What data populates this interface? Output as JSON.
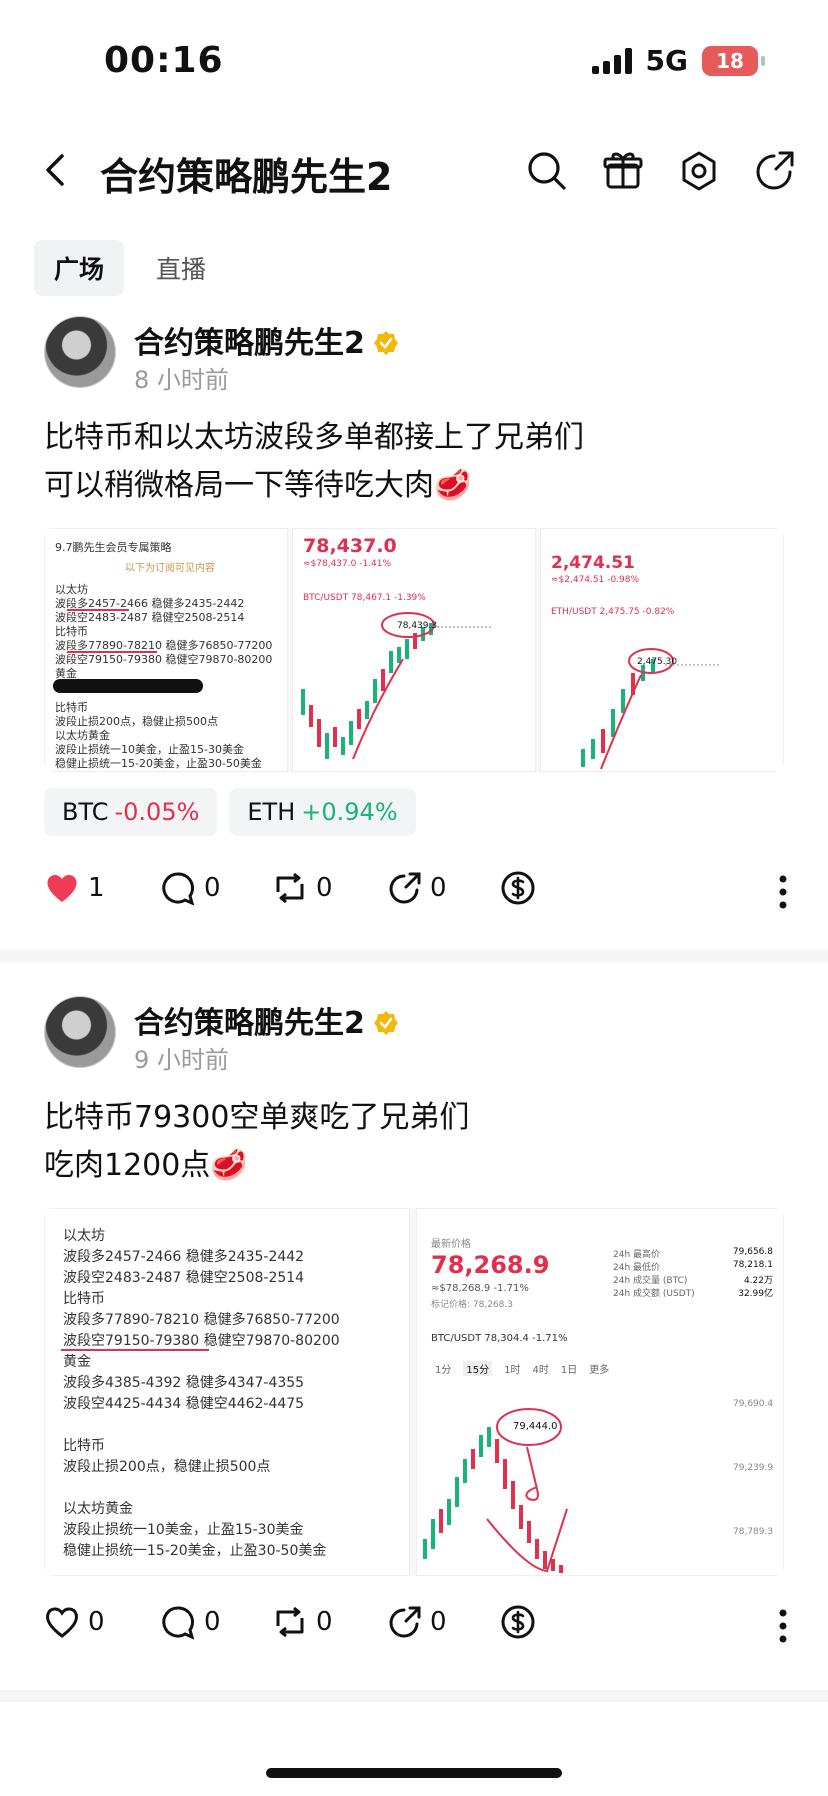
{
  "status": {
    "time": "00:16",
    "network": "5G",
    "battery": "18"
  },
  "nav": {
    "title": "合约策略鹏先生2"
  },
  "tabs": [
    {
      "label": "广场",
      "active": true
    },
    {
      "label": "直播",
      "active": false
    }
  ],
  "posts": [
    {
      "author": "合约策略鹏先生2",
      "time": "8 小时前",
      "lines": [
        "比特币和以太坊波段多单都接上了兄弟们",
        "可以稍微格局一下等待吃大肉🥩"
      ],
      "images": {
        "note_title": "9.7鹏先生会员专属策略",
        "note_sub": "以下为订阅可见内容",
        "note_lines": [
          "以太坊",
          "波段多2457-2466 稳健多2435-2442",
          "波段空2483-2487 稳健空2508-2514",
          "比特币",
          "波段多77890-78210 稳健多76850-77200",
          "波段空79150-79380 稳健空79870-80200",
          "黄金",
          "",
          "比特币",
          "波段止损200点，稳健止损500点",
          "以太坊黄金",
          "波段止损统一10美金，止盈15-30美金",
          "稳健止损统一15-20美金，止盈30-50美金"
        ],
        "btc_price": "78,437.0",
        "btc_sub": "≈$78,437.0  -1.41%",
        "btc_pair": "BTC/USDT  78,467.1 -1.39%",
        "btc_marker": "78,439.3",
        "eth_price": "2,474.51",
        "eth_sub": "≈$2,474.51  -0.98%",
        "eth_pair": "ETH/USDT  2,475.75 -0.82%",
        "eth_marker": "2,475.30"
      },
      "tickers": [
        {
          "symbol": "BTC",
          "change": "-0.05%",
          "dir": "down"
        },
        {
          "symbol": "ETH",
          "change": "+0.94%",
          "dir": "up"
        }
      ],
      "likes": "1",
      "comments": "0",
      "reposts": "0",
      "shares": "0",
      "liked": true
    },
    {
      "author": "合约策略鹏先生2",
      "time": "9 小时前",
      "lines": [
        "比特币79300空单爽吃了兄弟们",
        "吃肉1200点🥩"
      ],
      "images": {
        "note_lines": [
          "以太坊",
          "波段多2457-2466 稳健多2435-2442",
          "波段空2483-2487 稳健空2508-2514",
          "比特币",
          "波段多77890-78210 稳健多76850-77200",
          "波段空79150-79380 稳健空79870-80200",
          "黄金",
          "波段多4385-4392 稳健多4347-4355",
          "波段空4425-4434 稳健空4462-4475",
          "",
          "比特币",
          "波段止损200点，稳健止损500点",
          "",
          "以太坊黄金",
          "波段止损统一10美金，止盈15-30美金",
          "稳健止损统一15-20美金，止盈30-50美金"
        ],
        "price_label": "最新价格",
        "price": "78,268.9",
        "sub": "≈$78,268.9  -1.71%",
        "mark": "标记价格: 78,268.3",
        "pair": "BTC/USDT  78,304.4 -1.71%",
        "marker": "79,444.0",
        "stats": [
          [
            "24h 最高价",
            "79,656.8"
          ],
          [
            "24h 最低价",
            "78,218.1"
          ],
          [
            "24h 成交量 (BTC)",
            "4.22万"
          ],
          [
            "24h 成交额 (USDT)",
            "32.99亿"
          ]
        ],
        "intervals": [
          "1分",
          "15分",
          "1时",
          "4时",
          "1日",
          "更多"
        ],
        "axis": [
          "79,690.4",
          "79,239.9",
          "78,789.3"
        ]
      },
      "likes": "0",
      "comments": "0",
      "reposts": "0",
      "shares": "0",
      "liked": false
    }
  ],
  "colors": {
    "up": "#19b37a",
    "down": "#e0304d",
    "like": "#ef3b55"
  }
}
